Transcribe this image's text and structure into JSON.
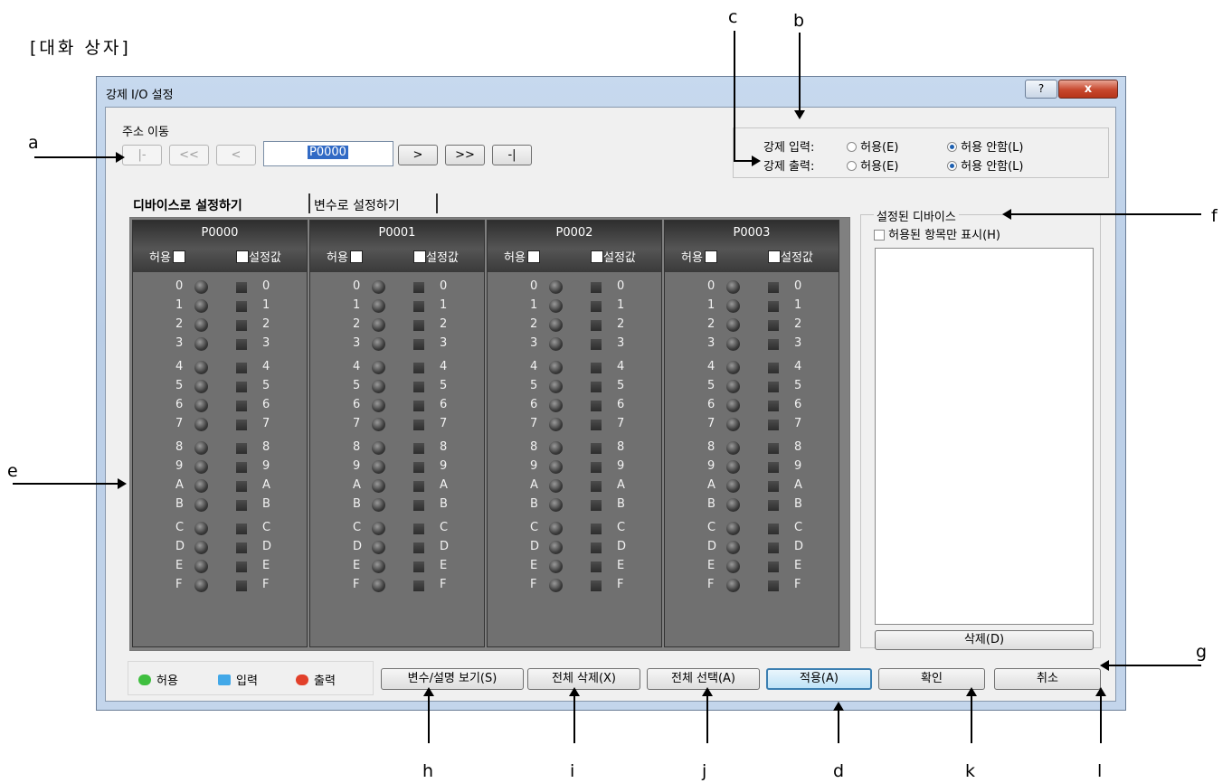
{
  "caption": "[대화 상자]",
  "annotations": {
    "a": "a",
    "b": "b",
    "c": "c",
    "d": "d",
    "e": "e",
    "f": "f",
    "g": "g",
    "h": "h",
    "i": "i",
    "j": "j",
    "k": "k",
    "l": "l"
  },
  "window": {
    "title": "강제 I/O 설정",
    "help_icon": "?",
    "close_icon": "x"
  },
  "address": {
    "label": "주소 이동",
    "first": "|-",
    "prev_page": "<<",
    "prev": "<",
    "value": "P0000",
    "next": ">",
    "next_page": ">>",
    "last": "-|"
  },
  "force": {
    "input_label": "강제 입력:",
    "output_label": "강제 출력:",
    "allow": "허용(E)",
    "deny": "허용 안함(L)",
    "input_selected": "deny",
    "output_selected": "deny"
  },
  "tabs": [
    {
      "label": "디바이스로 설정하기",
      "active": true
    },
    {
      "label": "변수로 설정하기",
      "active": false
    }
  ],
  "devices": [
    {
      "name": "P0000",
      "allow": "허용",
      "set": "설정값"
    },
    {
      "name": "P0001",
      "allow": "허용",
      "set": "설정값"
    },
    {
      "name": "P0002",
      "allow": "허용",
      "set": "설정값"
    },
    {
      "name": "P0003",
      "allow": "허용",
      "set": "설정값"
    }
  ],
  "bits": [
    "0",
    "1",
    "2",
    "3",
    "4",
    "5",
    "6",
    "7",
    "8",
    "9",
    "A",
    "B",
    "C",
    "D",
    "E",
    "F"
  ],
  "set_devices": {
    "title": "설정된 디바이스",
    "show_allowed": "허용된 항목만 표시(H)",
    "delete": "삭제(D)"
  },
  "legend": [
    {
      "label": "허용",
      "color": "#3fbf3f"
    },
    {
      "label": "입력",
      "color": "#42a8e8"
    },
    {
      "label": "출력",
      "color": "#e2402a"
    }
  ],
  "buttons": {
    "view_vars": "변수/설명 보기(S)",
    "delete_all": "전체 삭제(X)",
    "select_all": "전체 선택(A)",
    "apply": "적용(A)",
    "ok": "확인",
    "cancel": "취소"
  }
}
